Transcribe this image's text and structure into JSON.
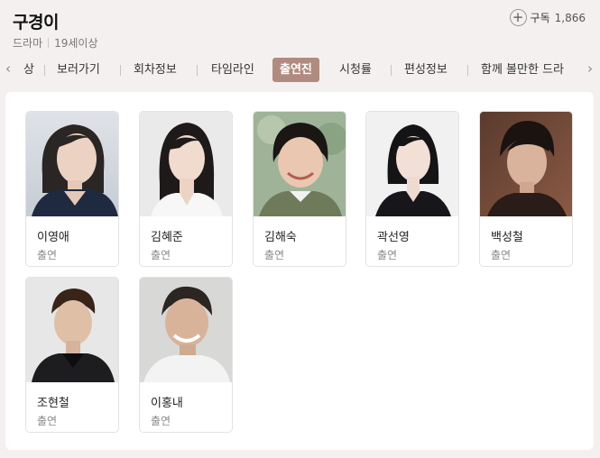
{
  "header": {
    "title": "구경이",
    "genre": "드라마",
    "rating": "19세이상",
    "subscribe_label": "구독",
    "subscribe_count": "1,866"
  },
  "tabs": [
    {
      "label": "상"
    },
    {
      "label": "보러가기"
    },
    {
      "label": "회차정보"
    },
    {
      "label": "타임라인"
    },
    {
      "label": "출연진",
      "active": true
    },
    {
      "label": "시청률"
    },
    {
      "label": "편성정보"
    },
    {
      "label": "함께 볼만한 드라"
    }
  ],
  "cast": [
    {
      "name": "이영애",
      "role": "출연"
    },
    {
      "name": "김혜준",
      "role": "출연"
    },
    {
      "name": "김해숙",
      "role": "출연"
    },
    {
      "name": "곽선영",
      "role": "출연"
    },
    {
      "name": "백성철",
      "role": "출연"
    },
    {
      "name": "조현철",
      "role": "출연"
    },
    {
      "name": "이홍내",
      "role": "출연"
    }
  ]
}
